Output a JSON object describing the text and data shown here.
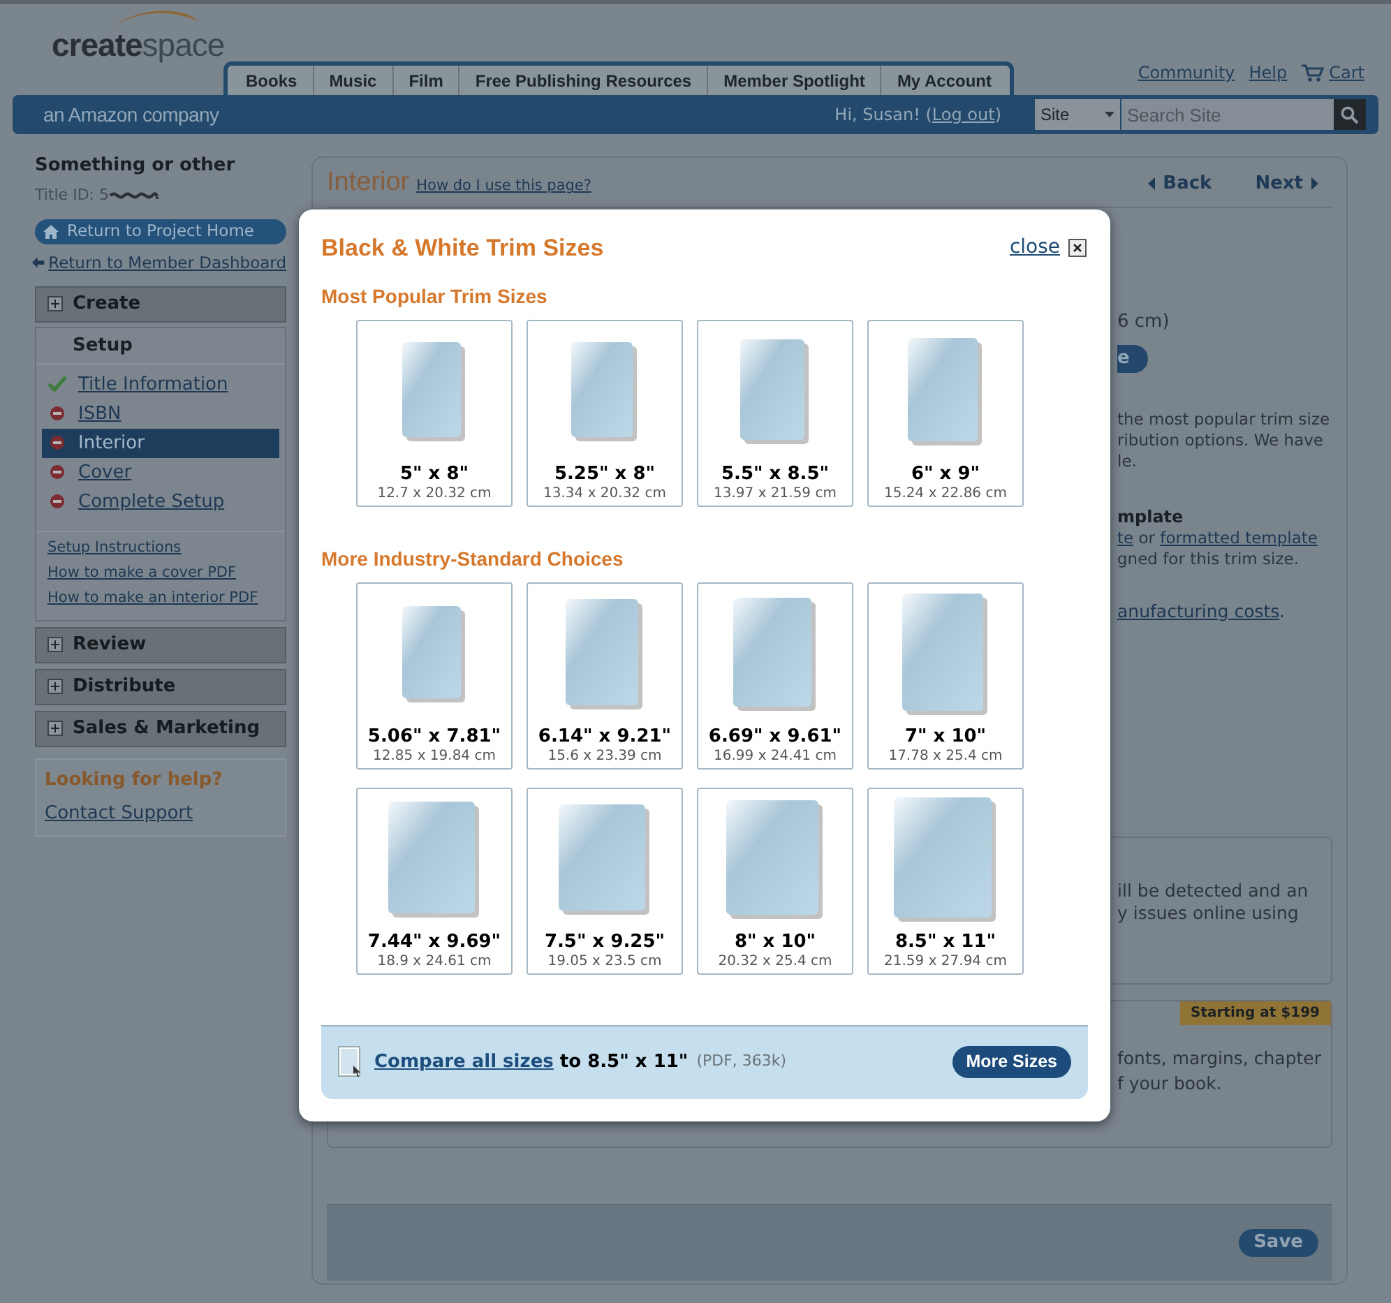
{
  "header": {
    "logo": {
      "bold_part": "create",
      "light_part": "space"
    },
    "tagline": "an Amazon company",
    "nav_tabs": [
      {
        "label": "Books"
      },
      {
        "label": "Music"
      },
      {
        "label": "Film"
      },
      {
        "label": "Free Publishing Resources"
      },
      {
        "label": "Member Spotlight"
      },
      {
        "label": "My Account"
      }
    ],
    "top_links": [
      {
        "label": "Community",
        "kind": "text"
      },
      {
        "label": "Help",
        "kind": "text"
      },
      {
        "label": "Cart",
        "kind": "cart"
      }
    ],
    "greeting": {
      "before": "Hi, Susan! (",
      "link": "Log out",
      "after": ")"
    },
    "search": {
      "scope": "Site",
      "placeholder": "Search Site"
    }
  },
  "sidebar": {
    "project_title": "Something or other",
    "title_id": "Title ID: 5",
    "project_home": "Return to Project Home",
    "dashboard": "Return to Member Dashboard",
    "sections": [
      {
        "label": "Create",
        "expanded": true,
        "subheading": "Setup",
        "steps": [
          {
            "label": "Title Information",
            "complete": true,
            "selected": false
          },
          {
            "label": "ISBN",
            "complete": false,
            "selected": false
          },
          {
            "label": "Interior",
            "complete": false,
            "selected": true
          },
          {
            "label": "Cover",
            "complete": false,
            "selected": false
          },
          {
            "label": "Complete Setup",
            "complete": false,
            "selected": false
          }
        ],
        "links": [
          "Setup Instructions",
          "How to make a cover PDF",
          "How to make an interior PDF"
        ]
      },
      {
        "label": "Review",
        "expanded": false
      },
      {
        "label": "Distribute",
        "expanded": false
      },
      {
        "label": "Sales & Marketing",
        "expanded": false
      }
    ],
    "help": {
      "title": "Looking for help?",
      "link": "Contact Support"
    }
  },
  "main": {
    "title": "Interior",
    "help_link": "How do I use this page?",
    "back": "Back",
    "next": "Next",
    "dimension_note": "6 cm)",
    "button_fragment": "e",
    "description_lines": [
      "the most popular trim size",
      "ribution options. We have",
      "le."
    ],
    "template_heading": "mplate",
    "template_line": {
      "link1": "te",
      "middle": " or ",
      "link2": "formatted template"
    },
    "template_note": "gned for this trim size.",
    "cost_link": "anufacturing costs",
    "cost_suffix": ".",
    "box1_lines": [
      "ill be detected and an",
      "y issues online using"
    ],
    "box2_badge": "Starting at $199",
    "box2_lines": [
      "fonts, margins, chapter",
      "f your book."
    ],
    "save": "Save"
  },
  "modal": {
    "title": "Black & White Trim Sizes",
    "close": "close",
    "sections": [
      {
        "heading": "Most Popular Trim Sizes",
        "rows": [
          [
            {
              "inches": "5\" x 8\"",
              "cm": "12.7 x 20.32 cm"
            },
            {
              "inches": "5.25\" x 8\"",
              "cm": "13.34 x 20.32 cm"
            },
            {
              "inches": "5.5\" x 8.5\"",
              "cm": "13.97 x 21.59 cm"
            },
            {
              "inches": "6\" x 9\"",
              "cm": "15.24 x 22.86 cm"
            }
          ]
        ]
      },
      {
        "heading": "More Industry-Standard Choices",
        "rows": [
          [
            {
              "inches": "5.06\" x 7.81\"",
              "cm": "12.85 x 19.84 cm"
            },
            {
              "inches": "6.14\" x 9.21\"",
              "cm": "15.6 x 23.39 cm"
            },
            {
              "inches": "6.69\" x 9.61\"",
              "cm": "16.99 x 24.41 cm"
            },
            {
              "inches": "7\" x 10\"",
              "cm": "17.78 x 25.4 cm"
            }
          ],
          [
            {
              "inches": "7.44\" x 9.69\"",
              "cm": "18.9 x 24.61 cm"
            },
            {
              "inches": "7.5\" x 9.25\"",
              "cm": "19.05 x 23.5 cm"
            },
            {
              "inches": "8\" x 10\"",
              "cm": "20.32 x 25.4 cm"
            },
            {
              "inches": "8.5\" x 11\"",
              "cm": "21.59 x 27.94 cm"
            }
          ]
        ]
      }
    ],
    "footer": {
      "link": "Compare all sizes",
      "text": "to 8.5\" x 11\"",
      "meta": "(PDF, 363k)",
      "button": "More Sizes"
    }
  }
}
